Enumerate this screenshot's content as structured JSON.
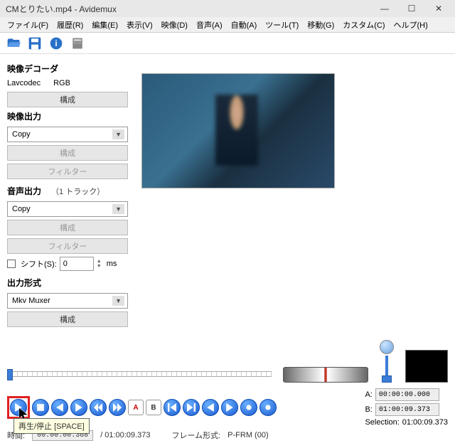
{
  "titlebar": {
    "title": "CMとりたい.mp4 - Avidemux"
  },
  "menu": {
    "file": "ファイル(F)",
    "recent": "履歴(R)",
    "edit": "編集(E)",
    "view": "表示(V)",
    "video": "映像(D)",
    "audio": "音声(A)",
    "auto": "自動(A)",
    "tools": "ツール(T)",
    "go": "移動(G)",
    "custom": "カスタム(C)",
    "help": "ヘルプ(H)"
  },
  "sections": {
    "decoder": "映像デコーダ",
    "video_out": "映像出力",
    "audio_out": "音声出力",
    "output_format": "出力形式"
  },
  "decoder": {
    "codec": "Lavcodec",
    "mode": "RGB",
    "configure": "構成"
  },
  "video_out": {
    "value": "Copy",
    "configure": "構成",
    "filter": "フィルター"
  },
  "audio_out": {
    "tracks": "（1 トラック）",
    "value": "Copy",
    "configure": "構成",
    "filter": "フィルター",
    "shift_label": "シフト(S):",
    "shift_value": "0",
    "ms": "ms"
  },
  "output_format": {
    "value": "Mkv Muxer",
    "configure": "構成"
  },
  "ab": {
    "a_label": "A:",
    "a_value": "00:00:00.000",
    "b_label": "B:",
    "b_value": "01:00:09.373",
    "selection_label": "Selection:",
    "selection_value": "01:00:09.373"
  },
  "status": {
    "time_label": "時間:",
    "time_value": "00:00:00.368",
    "total": "01:00:09.373",
    "frame_label": "フレーム形式:",
    "frame_value": "P-FRM (00)"
  },
  "tooltip": {
    "play": "再生/停止 [SPACE]"
  },
  "icons": {
    "min": "—",
    "max": "☐",
    "close": "✕"
  }
}
